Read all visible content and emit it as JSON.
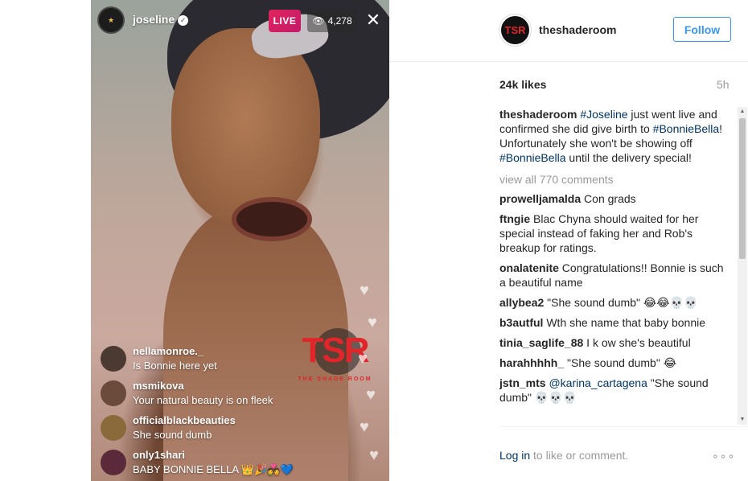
{
  "live": {
    "username": "joseline",
    "badge": "LIVE",
    "viewers": "4,278",
    "brand_name": "TSR",
    "brand_tagline": "THE SHADE ROOM",
    "comments": [
      {
        "user": "nellamonroe._",
        "text": "Is Bonnie here yet",
        "color": "#4a3a32"
      },
      {
        "user": "msmikova",
        "text": "Your natural beauty is on fleek",
        "color": "#6a4a3a"
      },
      {
        "user": "officialblackbeauties",
        "text": "She sound dumb",
        "color": "#8a6a3a"
      },
      {
        "user": "only1shari",
        "text": "BABY BONNIE BELLA 👑🎉💑💙",
        "color": "#5a2a3a"
      }
    ]
  },
  "post": {
    "username": "theshaderoom",
    "avatar_text": "TSR",
    "follow_label": "Follow",
    "likes": "24k likes",
    "time": "5h",
    "caption": {
      "user": "theshaderoom",
      "parts": [
        {
          "t": " "
        },
        {
          "t": "#Joseline",
          "tag": true
        },
        {
          "t": " just went live and confirmed she did give birth to "
        },
        {
          "t": "#BonnieBella",
          "tag": true
        },
        {
          "t": "! Unfortunately she won't be showing off "
        },
        {
          "t": "#BonnieBella",
          "tag": true
        },
        {
          "t": " until the delivery special!"
        }
      ]
    },
    "view_all": "view all 770 comments",
    "comments": [
      {
        "user": "prowelljamalda",
        "text": " Con grads"
      },
      {
        "user": "ftngie",
        "text": " Blac Chyna should waited for her special instead of faking her and Rob's breakup for ratings."
      },
      {
        "user": "onalatenite",
        "text": " Congratulations!! Bonnie is such a beautiful name"
      },
      {
        "user": "allybea2",
        "text": " \"She sound dumb\" 😂😂💀💀"
      },
      {
        "user": "b3autful",
        "text": " Wth she name that baby bonnie"
      },
      {
        "user": "tinia_saglife_88",
        "text": " I k ow she's beautiful"
      },
      {
        "user": "harahhhhh_",
        "text": " \"She sound dumb\" 😂"
      },
      {
        "user": "jstn_mts",
        "mention": "@karina_cartagena",
        "text": " \"She sound dumb\" 💀💀💀"
      }
    ],
    "login_link": "Log in",
    "login_rest": " to like or comment.",
    "more": "∘∘∘"
  }
}
